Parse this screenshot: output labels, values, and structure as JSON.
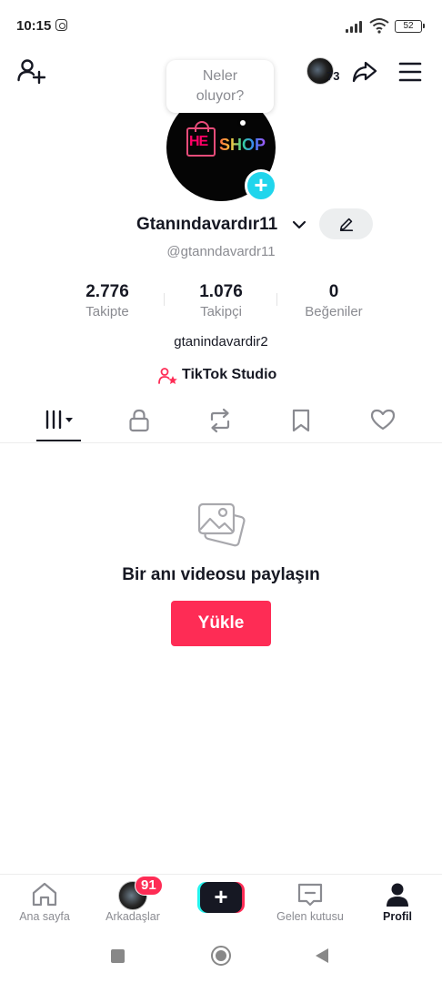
{
  "status_bar": {
    "time": "10:15",
    "battery": "52"
  },
  "header": {
    "notification_count": "73",
    "bubble_line1": "Neler",
    "bubble_line2": "oluyor?"
  },
  "profile": {
    "display_name": "Gtanındavardır11",
    "handle": "@gtanndavardr11",
    "bio": "gtanindavardir2",
    "logo_prefix": "HE",
    "logo_text": "SHOP",
    "studio_label": "TikTok Studio"
  },
  "stats": [
    {
      "value": "2.776",
      "label": "Takipte"
    },
    {
      "value": "1.076",
      "label": "Takipçi"
    },
    {
      "value": "0",
      "label": "Beğeniler"
    }
  ],
  "empty_state": {
    "title": "Bir anı videosu paylaşın",
    "upload_label": "Yükle"
  },
  "bottom_nav": {
    "home": "Ana sayfa",
    "friends": "Arkadaşlar",
    "friends_badge": "91",
    "create_symbol": "+",
    "inbox": "Gelen kutusu",
    "profile": "Profil"
  },
  "colors": {
    "accent": "#fe2c55",
    "cyan": "#20d5ec",
    "text": "#161823",
    "muted": "#8a8b91"
  }
}
